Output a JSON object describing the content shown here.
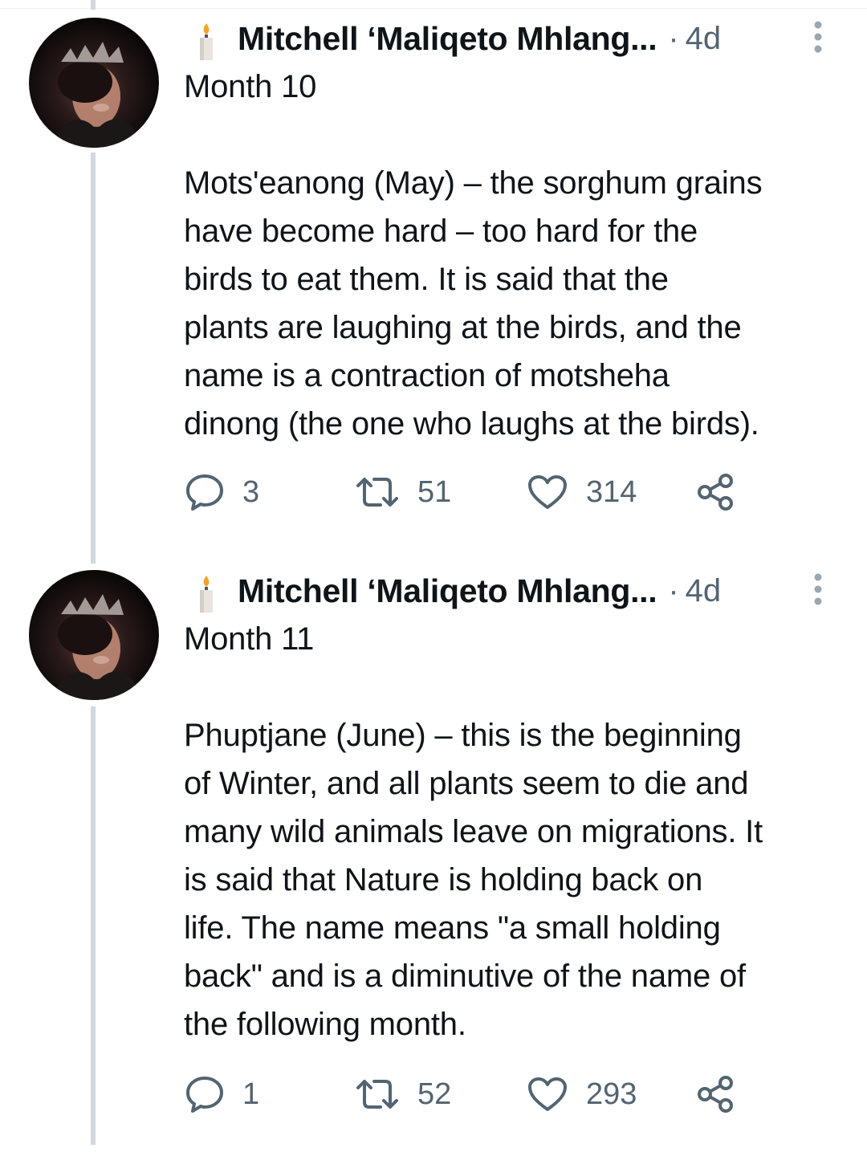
{
  "tweets": [
    {
      "author": "Mitchell ‘Maliqeto Mhlang...",
      "separator": "·",
      "time": "4d",
      "title": "Month 10",
      "body": "Mots'eanong (May) – the sorghum grains\nhave become hard – too hard for the\nbirds to eat them. It is said that the\nplants are laughing at the birds, and the\nname is a contraction of motsheha\ndinong (the one who laughs at the birds).",
      "replies": "3",
      "retweets": "51",
      "likes": "314"
    },
    {
      "author": "Mitchell ‘Maliqeto Mhlang...",
      "separator": "·",
      "time": "4d",
      "title": "Month 11",
      "body": "Phuptjane (June) – this is the beginning\nof Winter, and all plants seem to die and\nmany wild animals leave on migrations. It\nis said that Nature is holding back on\nlife. The name means \"a small holding\nback\" and is a diminutive of the name of\nthe following month.",
      "replies": "1",
      "retweets": "52",
      "likes": "293"
    }
  ],
  "icons": {
    "name_emoji": "candle-icon",
    "menu": "more-vertical-icon",
    "reply": "reply-icon",
    "retweet": "retweet-icon",
    "like": "heart-icon",
    "share": "share-icon"
  },
  "colors": {
    "text": "#0f1419",
    "secondary": "#536471",
    "thread_line": "#cfd9de"
  }
}
